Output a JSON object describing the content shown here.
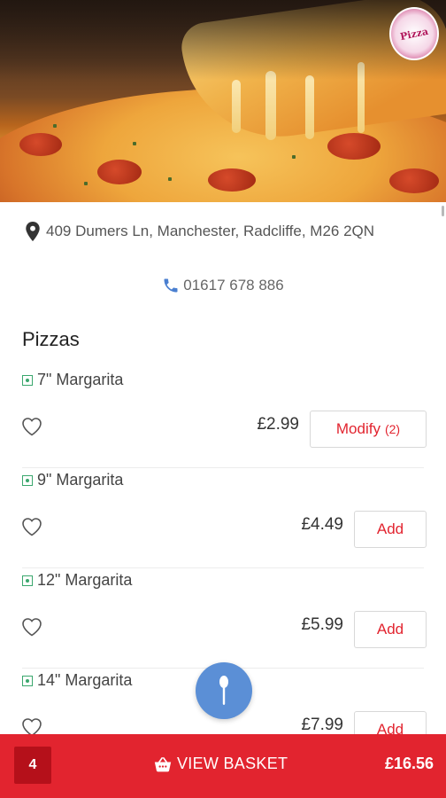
{
  "restaurant": {
    "address": "409 Dumers Ln, Manchester, Radcliffe, M26 2QN",
    "phone": "01617 678 886",
    "logo_text": "Pizza"
  },
  "menu": {
    "section_title": "Pizzas",
    "items": [
      {
        "name": "7\" Margarita",
        "price": "£2.99",
        "button_label": "Modify",
        "button_count": "(2)"
      },
      {
        "name": "9\" Margarita",
        "price": "£4.49",
        "button_label": "Add"
      },
      {
        "name": "12\" Margarita",
        "price": "£5.99",
        "button_label": "Add"
      },
      {
        "name": "14\" Margarita",
        "price": "£7.99",
        "button_label": "Add"
      }
    ]
  },
  "basket": {
    "count": "4",
    "label": "VIEW BASKET",
    "total": "£16.56"
  },
  "colors": {
    "accent": "#e2242f",
    "fab": "#5b8fd6",
    "veg": "#3aa76d"
  },
  "icons": [
    "map-pin-icon",
    "phone-icon",
    "veg-indicator-icon",
    "heart-icon",
    "spoon-icon",
    "basket-icon"
  ]
}
